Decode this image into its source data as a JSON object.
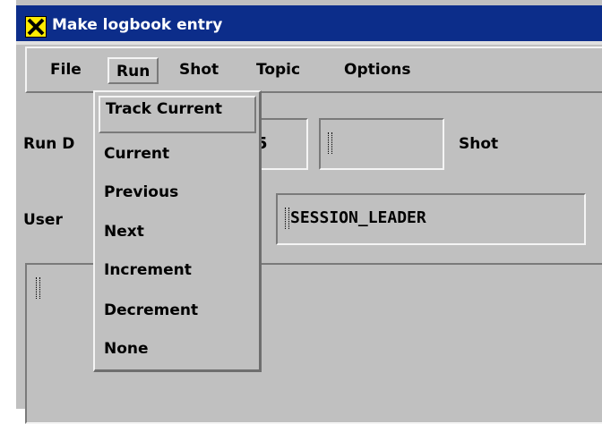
{
  "window": {
    "title": "Make logbook entry"
  },
  "menubar": {
    "items": [
      {
        "label": "File"
      },
      {
        "label": "Run"
      },
      {
        "label": "Shot"
      },
      {
        "label": "Topic"
      },
      {
        "label": "Options"
      }
    ]
  },
  "form": {
    "run_label": "Run D",
    "run_value_fragment": "5",
    "shot_label": "Shot",
    "shot_value": "",
    "user_label": "User",
    "user_value": "SESSION_LEADER",
    "text_value": ""
  },
  "run_menu": {
    "items": [
      {
        "label": "Track Current"
      },
      {
        "label": "Current"
      },
      {
        "label": "Previous"
      },
      {
        "label": "Next"
      },
      {
        "label": "Increment"
      },
      {
        "label": "Decrement"
      },
      {
        "label": "None"
      }
    ]
  },
  "colors": {
    "title_bar": "#0c2d8a",
    "window_bg": "#c0c0c0",
    "icon_bg": "#ffeb00"
  }
}
